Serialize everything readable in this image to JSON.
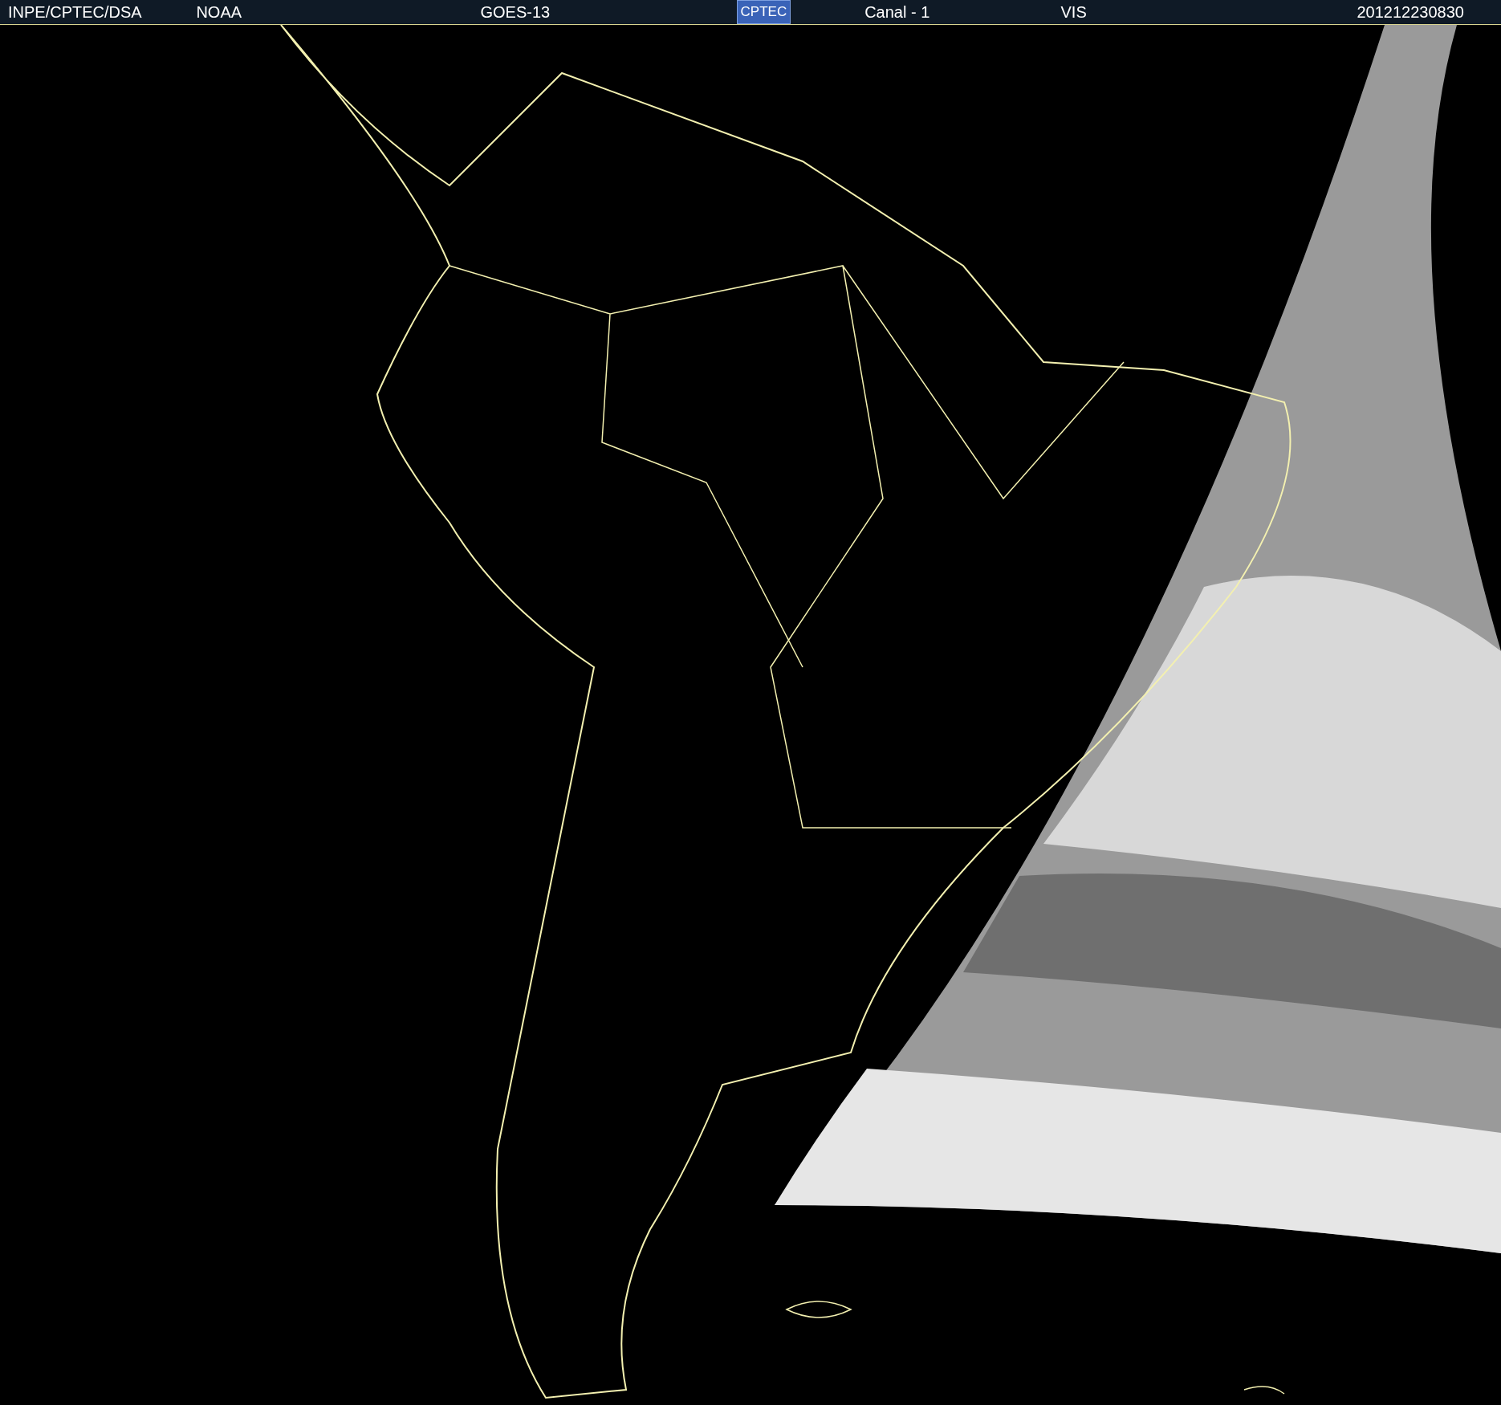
{
  "header": {
    "items": [
      {
        "kind": "text",
        "text": "INPE/CPTEC/DSA"
      },
      {
        "kind": "text",
        "text": "NOAA"
      },
      {
        "kind": "text",
        "text": "GOES-13"
      },
      {
        "kind": "logo",
        "text": "CPTEC"
      },
      {
        "kind": "text",
        "text": "Canal - 1"
      },
      {
        "kind": "text",
        "text": "VIS"
      },
      {
        "kind": "text",
        "text": "201212230830"
      }
    ]
  }
}
